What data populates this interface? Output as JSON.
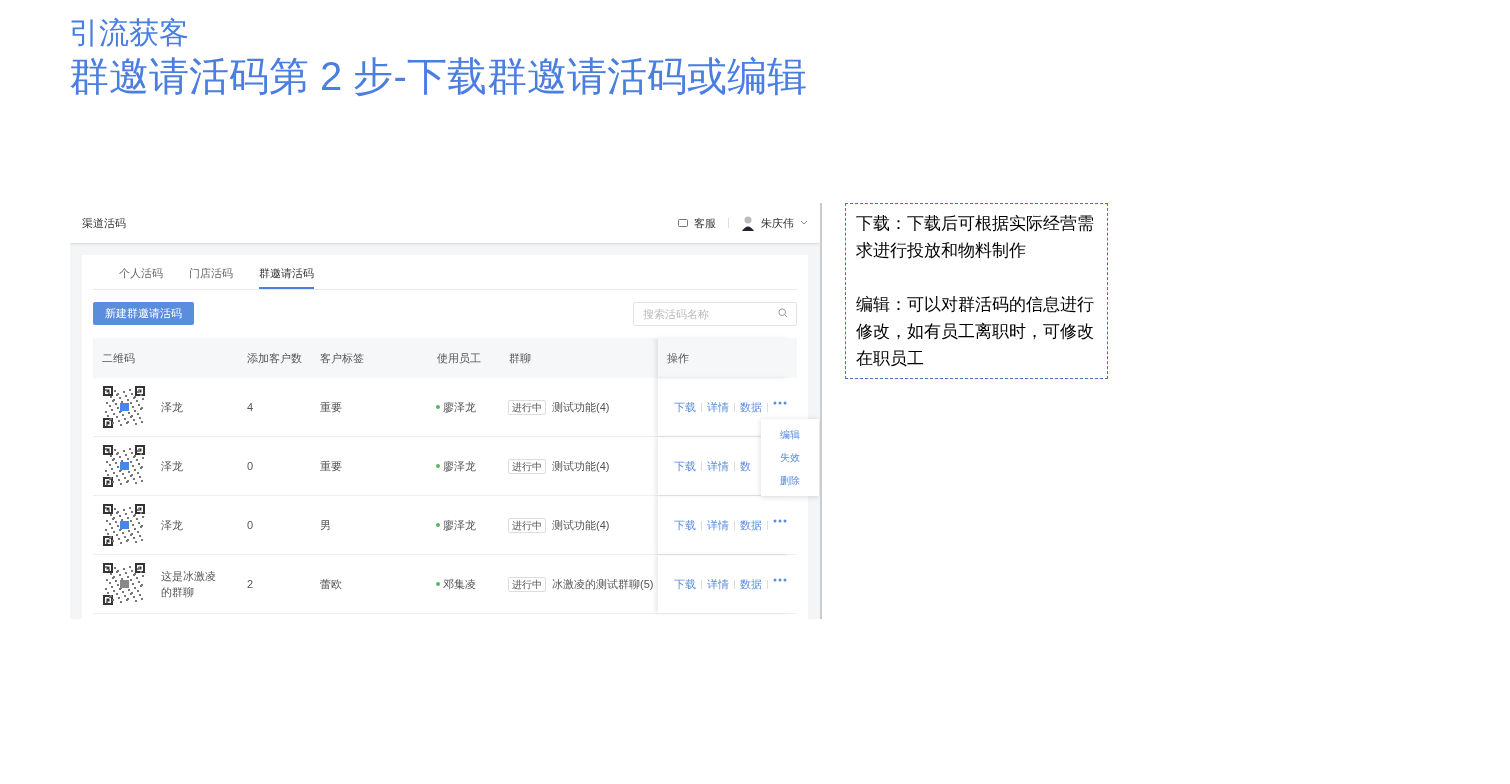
{
  "heading": {
    "section": "引流获客",
    "title": "群邀请活码第 2 步-下载群邀请活码或编辑"
  },
  "app": {
    "header": {
      "title": "渠道活码",
      "support": "客服",
      "user": "朱庆伟"
    },
    "tabs": [
      {
        "label": "个人活码",
        "selected": false
      },
      {
        "label": "门店活码",
        "selected": false
      },
      {
        "label": "群邀请活码",
        "selected": true
      }
    ],
    "new_button": "新建群邀请活码",
    "search": {
      "placeholder": "搜索活码名称"
    },
    "table": {
      "columns": [
        "二维码",
        "添加客户数",
        "客户标签",
        "使用员工",
        "群聊",
        "操作"
      ],
      "rows": [
        {
          "name": "泽龙",
          "count": "4",
          "tag": "重要",
          "staff": "廖泽龙",
          "status": "进行中",
          "group": "测试功能(4)",
          "actions": [
            "下载",
            "详情",
            "数据"
          ],
          "more": true,
          "menu": [
            "编辑",
            "失效",
            "删除"
          ]
        },
        {
          "name": "泽龙",
          "count": "0",
          "tag": "重要",
          "staff": "廖泽龙",
          "status": "进行中",
          "group": "测试功能(4)",
          "actions": [
            "下载",
            "详情",
            "数"
          ],
          "more": false
        },
        {
          "name": "泽龙",
          "count": "0",
          "tag": "男",
          "staff": "廖泽龙",
          "status": "进行中",
          "group": "测试功能(4)",
          "actions": [
            "下载",
            "详情",
            "数据"
          ],
          "more": true
        },
        {
          "name": "这是冰激凌的群聊",
          "count": "2",
          "tag": "蕾欧",
          "staff": "邓集凌",
          "status": "进行中",
          "group": "冰激凌的测试群聊(5)",
          "actions": [
            "下载",
            "详情",
            "数据"
          ],
          "more": true
        }
      ]
    }
  },
  "note": {
    "paragraphs": [
      "下载：下载后可根据实际经营需求进行投放和物料制作",
      "编辑：可以对群活码的信息进行修改，如有员工离职时，可修改在职员工"
    ]
  }
}
